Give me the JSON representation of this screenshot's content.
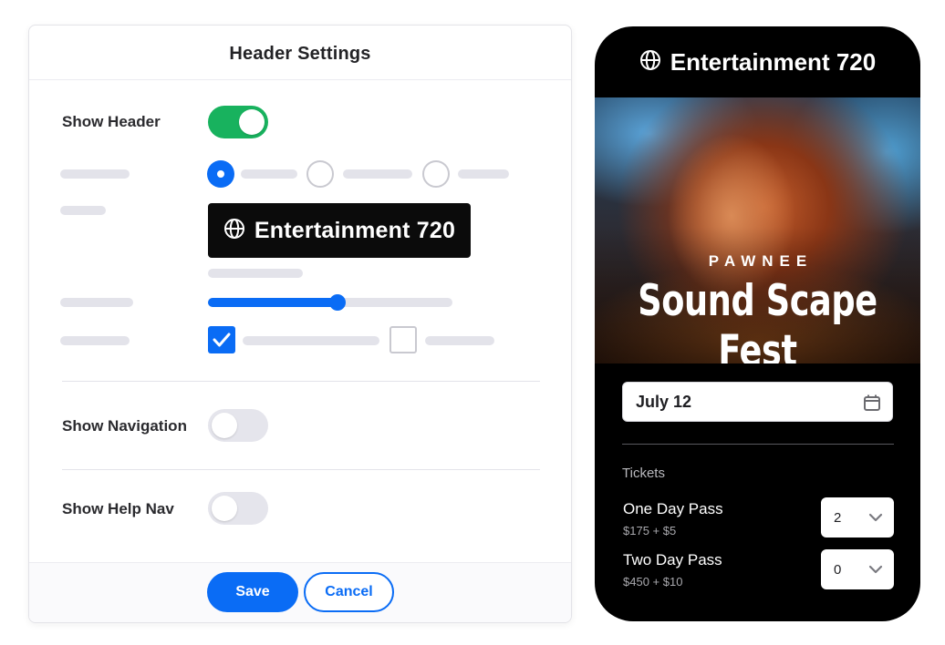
{
  "colors": {
    "accent_blue": "#0a6cf5",
    "toggle_on_green": "#18b25e",
    "toggle_off_gray": "#e5e5ec",
    "placeholder_gray": "#e3e3ea",
    "phone_background": "#000000"
  },
  "panel": {
    "title": "Header Settings",
    "show_header": {
      "label": "Show Header",
      "enabled": true
    },
    "style_radio": {
      "selected_index": 0
    },
    "brand_preview": {
      "icon": "globe-icon",
      "text": "Entertainment 720"
    },
    "slider": {
      "value_percent": 53
    },
    "checkboxes": {
      "first_checked": true,
      "second_checked": false
    },
    "show_navigation": {
      "label": "Show Navigation",
      "enabled": false
    },
    "show_help_nav": {
      "label": "Show Help Nav",
      "enabled": false
    },
    "footer": {
      "save_label": "Save",
      "cancel_label": "Cancel"
    }
  },
  "phone": {
    "brand": {
      "icon": "globe-icon",
      "text": "Entertainment 720"
    },
    "hero": {
      "kicker": "PAWNEE",
      "title": "Sound Scape Fest"
    },
    "date_field": {
      "value": "July 12",
      "icon": "calendar-icon"
    },
    "tickets_label": "Tickets",
    "tickets": [
      {
        "name": "One Day Pass",
        "price": "$175 + $5",
        "quantity": "2"
      },
      {
        "name": "Two Day Pass",
        "price": "$450 + $10",
        "quantity": "0"
      }
    ]
  }
}
